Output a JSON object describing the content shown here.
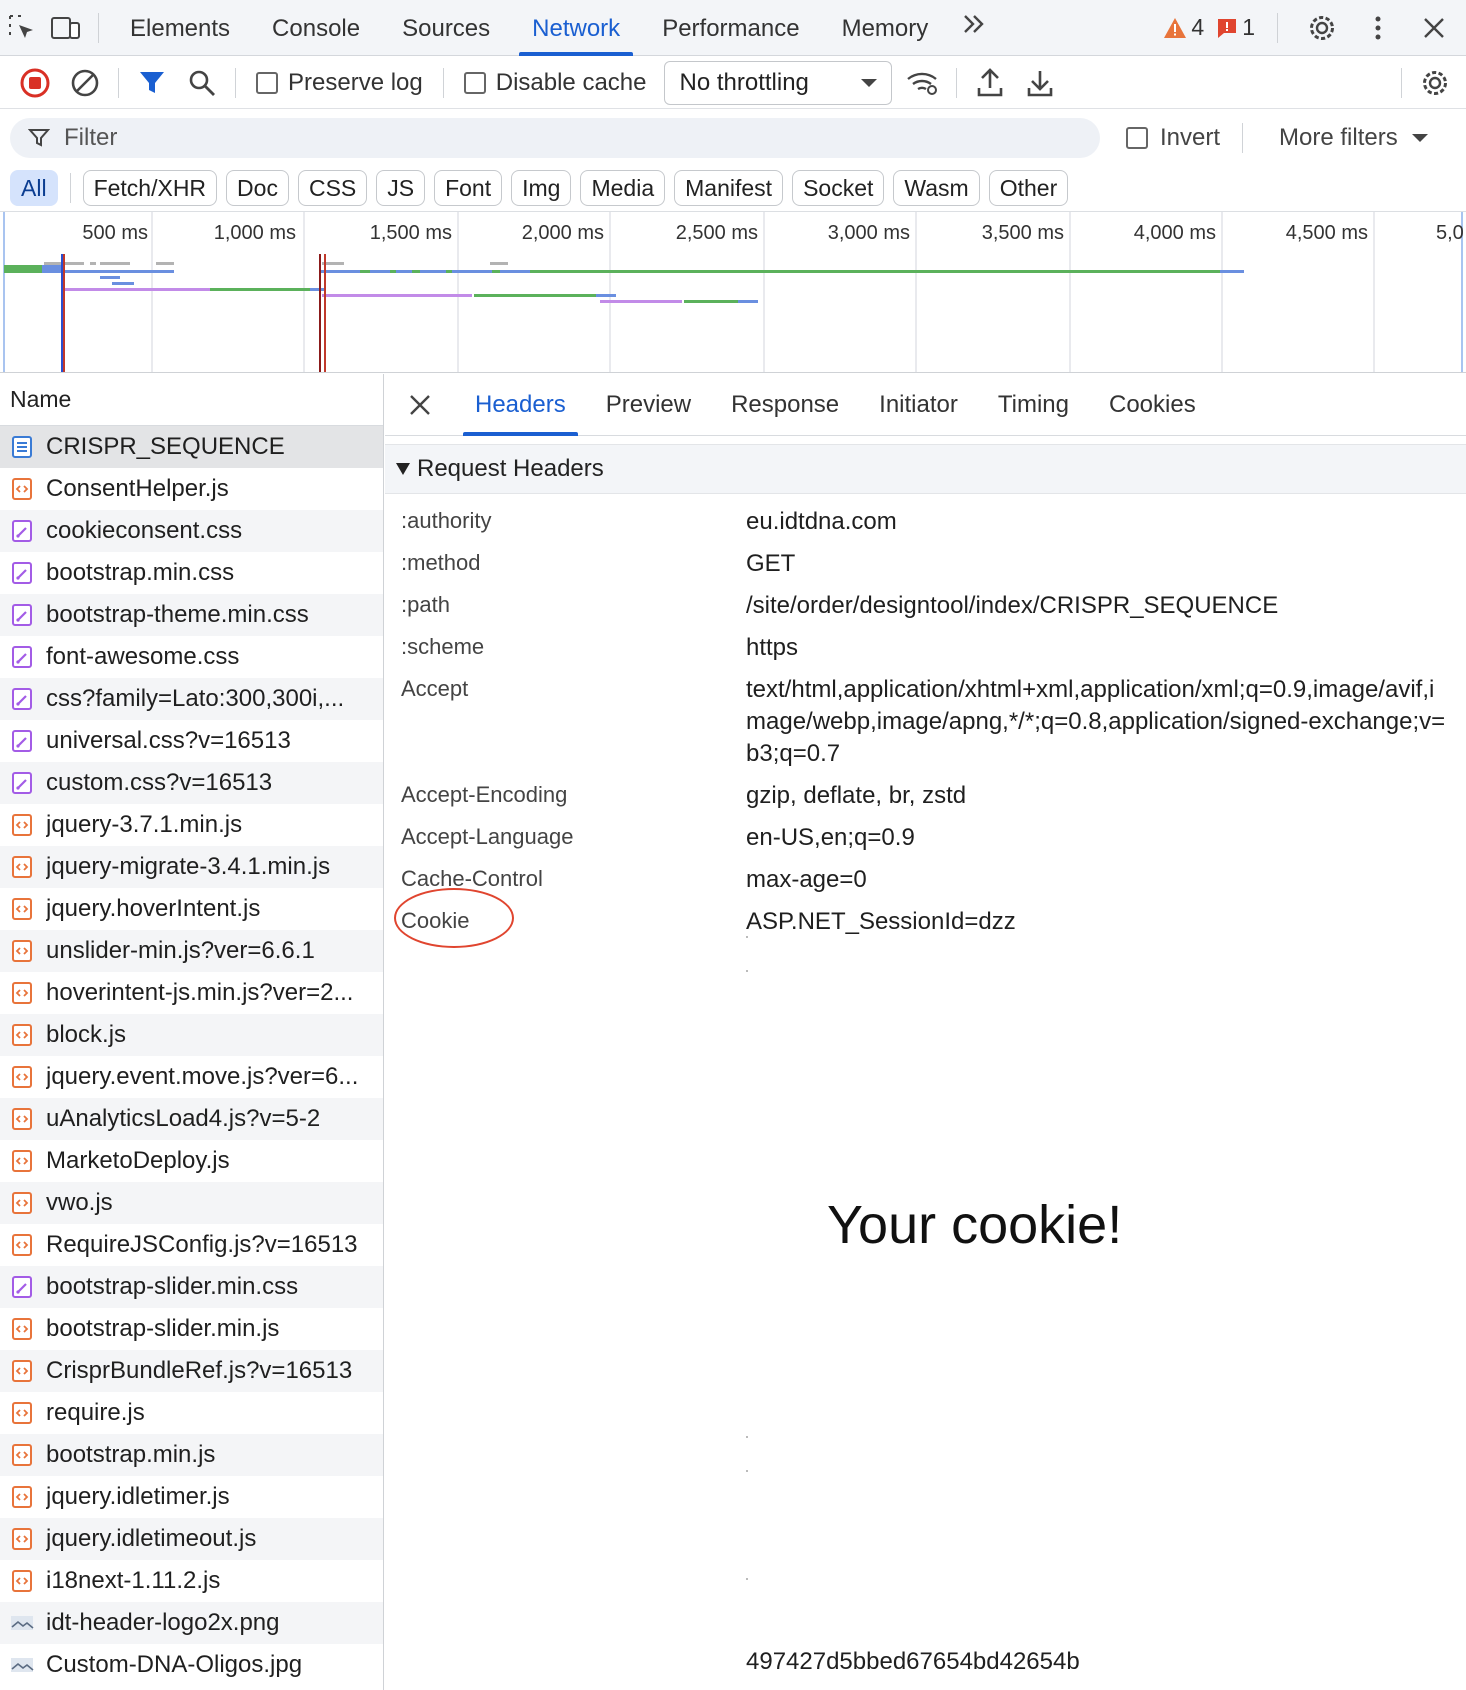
{
  "topbar": {
    "tabs": [
      "Elements",
      "Console",
      "Sources",
      "Network",
      "Performance",
      "Memory"
    ],
    "active_tab": "Network",
    "warnings_count": "4",
    "errors_count": "1"
  },
  "toolbar": {
    "preserve_log_label": "Preserve log",
    "disable_cache_label": "Disable cache",
    "throttling_value": "No throttling"
  },
  "filter": {
    "placeholder": "Filter",
    "invert_label": "Invert",
    "more_filters_label": "More filters"
  },
  "type_chips": [
    "All",
    "Fetch/XHR",
    "Doc",
    "CSS",
    "JS",
    "Font",
    "Img",
    "Media",
    "Manifest",
    "Socket",
    "Wasm",
    "Other"
  ],
  "timeline": {
    "tick_labels": [
      "500 ms",
      "1,000 ms",
      "1,500 ms",
      "2,000 ms",
      "2,500 ms",
      "3,000 ms",
      "3,500 ms",
      "4,000 ms",
      "4,500 ms",
      "5,0"
    ]
  },
  "request_list": {
    "header": "Name",
    "rows": [
      {
        "name": "CRISPR_SEQUENCE",
        "type": "doc"
      },
      {
        "name": "ConsentHelper.js",
        "type": "js"
      },
      {
        "name": "cookieconsent.css",
        "type": "css"
      },
      {
        "name": "bootstrap.min.css",
        "type": "css"
      },
      {
        "name": "bootstrap-theme.min.css",
        "type": "css"
      },
      {
        "name": "font-awesome.css",
        "type": "css"
      },
      {
        "name": "css?family=Lato:300,300i,...",
        "type": "css"
      },
      {
        "name": "universal.css?v=16513",
        "type": "css"
      },
      {
        "name": "custom.css?v=16513",
        "type": "css"
      },
      {
        "name": "jquery-3.7.1.min.js",
        "type": "js"
      },
      {
        "name": "jquery-migrate-3.4.1.min.js",
        "type": "js"
      },
      {
        "name": "jquery.hoverIntent.js",
        "type": "js"
      },
      {
        "name": "unslider-min.js?ver=6.6.1",
        "type": "js"
      },
      {
        "name": "hoverintent-js.min.js?ver=2...",
        "type": "js"
      },
      {
        "name": "block.js",
        "type": "js"
      },
      {
        "name": "jquery.event.move.js?ver=6...",
        "type": "js"
      },
      {
        "name": "uAnalyticsLoad4.js?v=5-2",
        "type": "js"
      },
      {
        "name": "MarketoDeploy.js",
        "type": "js"
      },
      {
        "name": "vwo.js",
        "type": "js"
      },
      {
        "name": "RequireJSConfig.js?v=16513",
        "type": "js"
      },
      {
        "name": "bootstrap-slider.min.css",
        "type": "css"
      },
      {
        "name": "bootstrap-slider.min.js",
        "type": "js"
      },
      {
        "name": "CrisprBundleRef.js?v=16513",
        "type": "js"
      },
      {
        "name": "require.js",
        "type": "js"
      },
      {
        "name": "bootstrap.min.js",
        "type": "js"
      },
      {
        "name": "jquery.idletimer.js",
        "type": "js"
      },
      {
        "name": "jquery.idletimeout.js",
        "type": "js"
      },
      {
        "name": "i18next-1.11.2.js",
        "type": "js"
      },
      {
        "name": "idt-header-logo2x.png",
        "type": "img"
      },
      {
        "name": "Custom-DNA-Oligos.jpg",
        "type": "img"
      }
    ]
  },
  "detail": {
    "tabs": [
      "Headers",
      "Preview",
      "Response",
      "Initiator",
      "Timing",
      "Cookies"
    ],
    "active_tab": "Headers",
    "section_title": "Request Headers",
    "headers": [
      {
        "key": ":authority",
        "value": "eu.idtdna.com"
      },
      {
        "key": ":method",
        "value": "GET"
      },
      {
        "key": ":path",
        "value": "/site/order/designtool/index/CRISPR_SEQUENCE"
      },
      {
        "key": ":scheme",
        "value": "https"
      },
      {
        "key": "Accept",
        "value": "text/html,application/xhtml+xml,application/xml;q=0.9,image/avif,image/webp,image/apng,*/*;q=0.8,application/signed-exchange;v=b3;q=0.7"
      },
      {
        "key": "Accept-Encoding",
        "value": "gzip, deflate, br, zstd"
      },
      {
        "key": "Accept-Language",
        "value": "en-US,en;q=0.9"
      },
      {
        "key": "Cache-Control",
        "value": "max-age=0"
      },
      {
        "key": "Cookie",
        "value": "ASP.NET_SessionId=dzz"
      }
    ],
    "annotation": "Your cookie!",
    "cookie_tail": "497427d5bbed67654bd42654b"
  },
  "colors": {
    "accent": "#1a5fd1",
    "annotation_circle": "#e0452f",
    "js_icon": "#e8743b",
    "css_icon": "#a35ce6",
    "doc_icon": "#3a7bd5"
  }
}
